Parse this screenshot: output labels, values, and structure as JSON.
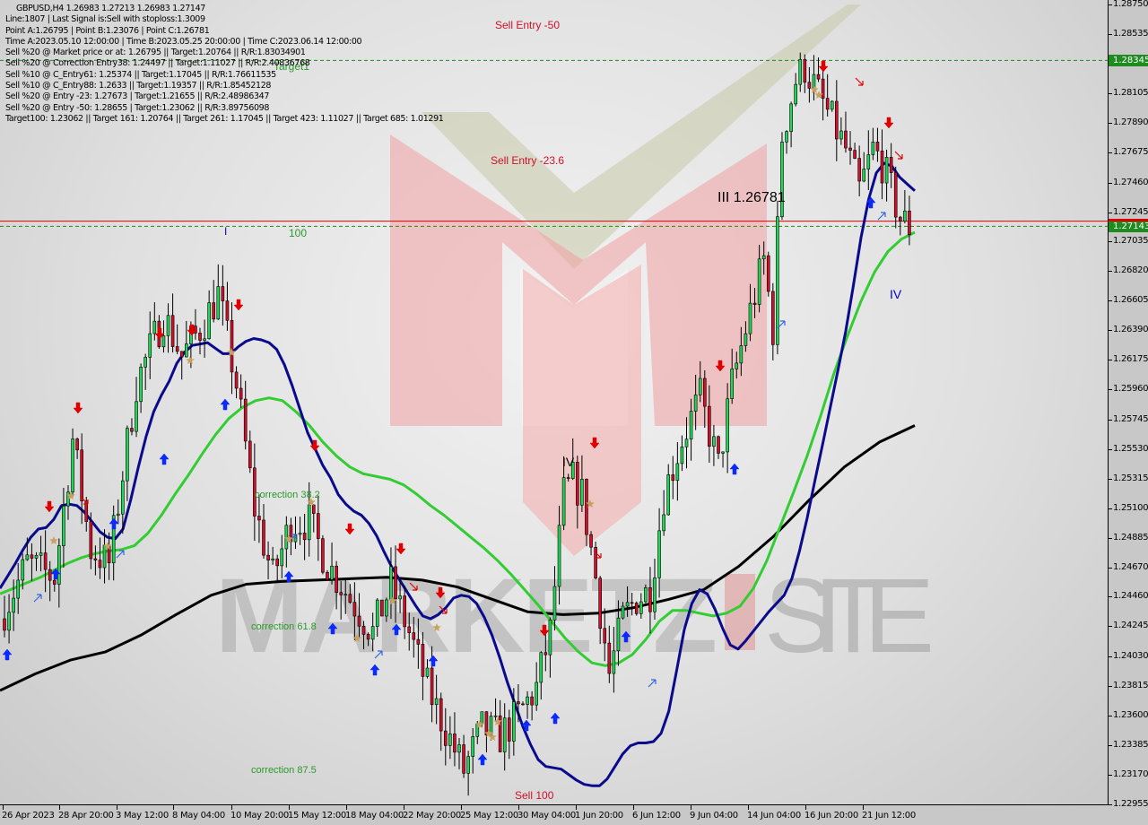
{
  "chart_data": {
    "type": "candlestick",
    "symbol": "GBPUSD",
    "timeframe": "H4",
    "ohlc_header": {
      "open": "1.26983",
      "high": "1.27213",
      "low": "1.26983",
      "close": "1.27147"
    },
    "info_lines": [
      "GBPUSD,H4  1.26983 1.27213 1.26983 1.27147",
      "Line:1807 | Last Signal is:Sell with stoploss:1.3009",
      "Point A:1.26795 | Point B:1.23076 | Point C:1.26781",
      "Time A:2023.05.10 12:00:00 | Time B:2023.05.25 20:00:00 | Time C:2023.06.14 12:00:00",
      "Sell %20 @ Market price or at: 1.26795 || Target:1.20764 || R/R:1.83034901",
      "Sell %20 @ Correction Entry38: 1.24497 || Target:1.11027 || R/R:2.40836768",
      "Sell %10 @ C_Entry61: 1.25374 || Target:1.17045 || R/R:1.76611535",
      "Sell %10 @ C_Entry88: 1.2633 || Target:1.19357 || R/R:1.85452128",
      "Sell %20 @ Entry -23: 1.27673 | Target:1.21655 || R/R:2.48986347",
      "Sell %20 @ Entry -50: 1.28655 | Target:1.23062 || R/R:3.89756098",
      "Target100: 1.23062 || Target 161: 1.20764 || Target 261: 1.17045 || Target 423: 1.11027 || Target 685: 1.01291"
    ],
    "y_axis": {
      "ylim": [
        1.2284,
        1.288
      ],
      "ticks": [
        "1.28750",
        "1.28535",
        "1.28320",
        "1.28105",
        "1.27890",
        "1.27675",
        "1.27460",
        "1.27245",
        "1.27035",
        "1.26820",
        "1.26605",
        "1.26390",
        "1.26175",
        "1.25960",
        "1.25745",
        "1.25530",
        "1.25315",
        "1.25100",
        "1.24885",
        "1.24670",
        "1.24460",
        "1.24245",
        "1.24030",
        "1.23815",
        "1.23600",
        "1.23385",
        "1.23170",
        "1.22955"
      ]
    },
    "x_axis": {
      "ticks": [
        "26 Apr 2023",
        "28 Apr 20:00",
        "3 May 12:00",
        "8 May 04:00",
        "10 May 20:00",
        "15 May 12:00",
        "18 May 04:00",
        "22 May 20:00",
        "25 May 12:00",
        "30 May 04:00",
        "1 Jun 20:00",
        "6 Jun 12:00",
        "9 Jun 04:00",
        "14 Jun 04:00",
        "16 Jun 20:00",
        "21 Jun 12:00"
      ]
    },
    "horizontal_lines": [
      {
        "name": "target1",
        "price": 1.28345,
        "style": "dashed",
        "color": "#1e8c1e",
        "label": "Target1"
      },
      {
        "name": "current-bid",
        "price": 1.27143,
        "style": "dashed",
        "color": "#1e8c1e"
      },
      {
        "name": "stop-red",
        "price": 1.2718,
        "style": "solid",
        "color": "#e00000"
      }
    ],
    "price_tags": [
      {
        "price": "1.28345",
        "color": "#1e8c1e"
      },
      {
        "price": "1.27143",
        "color": "#1e8c1e"
      }
    ],
    "annotations": [
      {
        "text": "Sell Entry -50",
        "color": "#d0102a",
        "price": 1.2861,
        "time_index": 96
      },
      {
        "text": "Sell Entry -23.6",
        "color": "#d0102a",
        "price": 1.276,
        "time_index": 96
      },
      {
        "text": "Target1",
        "color": "#2a9a2a",
        "price": 1.283,
        "time_index": 55
      },
      {
        "text": "100",
        "color": "#2a9a2a",
        "price": 1.2707,
        "time_index": 55
      },
      {
        "text": "I",
        "color": "#0000cc",
        "price": 1.2708,
        "time_index": 42
      },
      {
        "text": "III 1.26781",
        "color": "#000000",
        "price": 1.2742,
        "time_index": 142
      },
      {
        "text": "IV",
        "color": "#0000cc",
        "price": 1.2643,
        "time_index": 178
      },
      {
        "text": "IV",
        "color": "#000000",
        "price": 1.2541,
        "time_index": 112
      },
      {
        "text": "correction 38.2",
        "color": "#2a9a2a",
        "price": 1.2528,
        "time_index": 48
      },
      {
        "text": "correction 61.8",
        "color": "#2a9a2a",
        "price": 1.2427,
        "time_index": 48
      },
      {
        "text": "correction 87.5",
        "color": "#2a9a2a",
        "price": 1.2318,
        "time_index": 48
      },
      {
        "text": "Sell 100",
        "color": "#d0102a",
        "price": 1.23,
        "time_index": 102
      }
    ],
    "series": [
      {
        "name": "MA-fast",
        "color": "#0a0a8c",
        "values": [
          1.2452,
          1.2461,
          1.247,
          1.248,
          1.2489,
          1.2495,
          1.2496,
          1.2502,
          1.2512,
          1.2513,
          1.2512,
          1.2507,
          1.25,
          1.2493,
          1.2489,
          1.2488,
          1.2495,
          1.2516,
          1.254,
          1.2562,
          1.258,
          1.2592,
          1.2602,
          1.2615,
          1.2623,
          1.2628,
          1.2629,
          1.263,
          1.2626,
          1.2622,
          1.2622,
          1.2627,
          1.2631,
          1.2633,
          1.2632,
          1.263,
          1.2625,
          1.2614,
          1.2599,
          1.2582,
          1.2565,
          1.2553,
          1.2541,
          1.2532,
          1.252,
          1.2513,
          1.2508,
          1.2505,
          1.2499,
          1.249,
          1.2478,
          1.2467,
          1.2458,
          1.2449,
          1.244,
          1.2432,
          1.243,
          1.2433,
          1.2438,
          1.2445,
          1.2447,
          1.2446,
          1.2441,
          1.2431,
          1.2418,
          1.2402,
          1.2384,
          1.2368,
          1.2352,
          1.2339,
          1.2328,
          1.2323,
          1.2322,
          1.2321,
          1.2317,
          1.2313,
          1.231,
          1.2309,
          1.2309,
          1.2314,
          1.2323,
          1.2332,
          1.2338,
          1.234,
          1.234,
          1.2341,
          1.2347,
          1.2363,
          1.2392,
          1.2422,
          1.2441,
          1.2451,
          1.2448,
          1.2437,
          1.2423,
          1.2411,
          1.2408,
          1.2414,
          1.2421,
          1.2428,
          1.2435,
          1.2441,
          1.2447,
          1.2459,
          1.2479,
          1.2503,
          1.253,
          1.2556,
          1.2583,
          1.261,
          1.2638,
          1.2671,
          1.2706,
          1.2734,
          1.2753,
          1.276,
          1.2758,
          1.275,
          1.2745,
          1.274
        ]
      },
      {
        "name": "MA-slow",
        "color": "#33cc33",
        "values": [
          1.2448,
          1.2452,
          1.2456,
          1.246,
          1.2465,
          1.247,
          1.2474,
          1.2477,
          1.2479,
          1.248,
          1.2483,
          1.2492,
          1.2505,
          1.252,
          1.2534,
          1.2549,
          1.2563,
          1.2575,
          1.2583,
          1.2588,
          1.259,
          1.2588,
          1.258,
          1.257,
          1.2558,
          1.2548,
          1.254,
          1.2535,
          1.2533,
          1.2531,
          1.2527,
          1.252,
          1.2512,
          1.2505,
          1.2497,
          1.2489,
          1.2481,
          1.2472,
          1.2462,
          1.2451,
          1.244,
          1.2428,
          1.2416,
          1.2406,
          1.2398,
          1.2396,
          1.2398,
          1.2404,
          1.2415,
          1.2428,
          1.2436,
          1.2436,
          1.2434,
          1.2432,
          1.2434,
          1.2439,
          1.2452,
          1.2472,
          1.2497,
          1.2522,
          1.2548,
          1.2577,
          1.2608,
          1.2635,
          1.266,
          1.2681,
          1.2696,
          1.2705,
          1.271
        ]
      },
      {
        "name": "MA-long",
        "color": "#000000",
        "values": [
          1.2378,
          1.239,
          1.24,
          1.2406,
          1.2418,
          1.2433,
          1.2447,
          1.2455,
          1.2457,
          1.2458,
          1.2459,
          1.246,
          1.2458,
          1.2453,
          1.2444,
          1.2435,
          1.2433,
          1.2434,
          1.2438,
          1.2444,
          1.2451,
          1.2468,
          1.249,
          1.2516,
          1.254,
          1.2558,
          1.257
        ]
      }
    ],
    "signals": [
      {
        "type": "sell-arrow",
        "color": "#e00000",
        "count": 13
      },
      {
        "type": "buy-arrow",
        "color": "#0a2aff",
        "count": 17
      },
      {
        "type": "sell-hollow-arrow",
        "color": "#e00000",
        "count": 9
      },
      {
        "type": "buy-hollow-arrow",
        "color": "#3366dd",
        "count": 8
      },
      {
        "type": "star",
        "color": "#c8a060",
        "count": 16
      }
    ],
    "watermark": {
      "text_left": "MARKETZ",
      "text_right": "SITE"
    },
    "xlabel": "",
    "ylabel": "",
    "grid": false
  }
}
